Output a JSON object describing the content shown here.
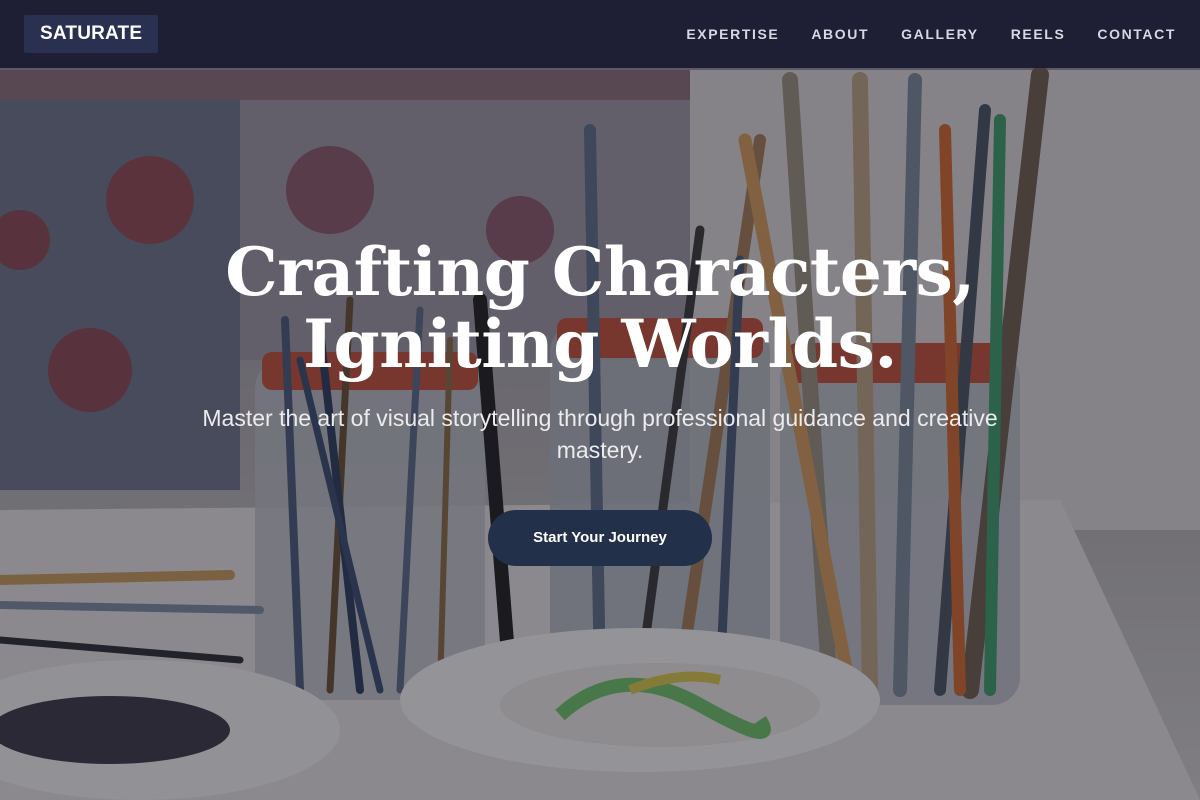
{
  "nav": {
    "logo": "SATURATE",
    "links": [
      {
        "label": "EXPERTISE"
      },
      {
        "label": "ABOUT"
      },
      {
        "label": "GALLERY"
      },
      {
        "label": "REELS"
      },
      {
        "label": "CONTACT"
      }
    ]
  },
  "hero": {
    "title_line1": "Crafting Characters,",
    "title_line2": "Igniting Worlds.",
    "subtitle": "Master the art of visual storytelling through professional guidance and creative mastery.",
    "cta_label": "Start Your Journey"
  },
  "colors": {
    "navbar_bg": "#1c1c32",
    "logo_bg": "#2a3150",
    "cta_bg": "#233049",
    "text_light": "#ffffff"
  }
}
